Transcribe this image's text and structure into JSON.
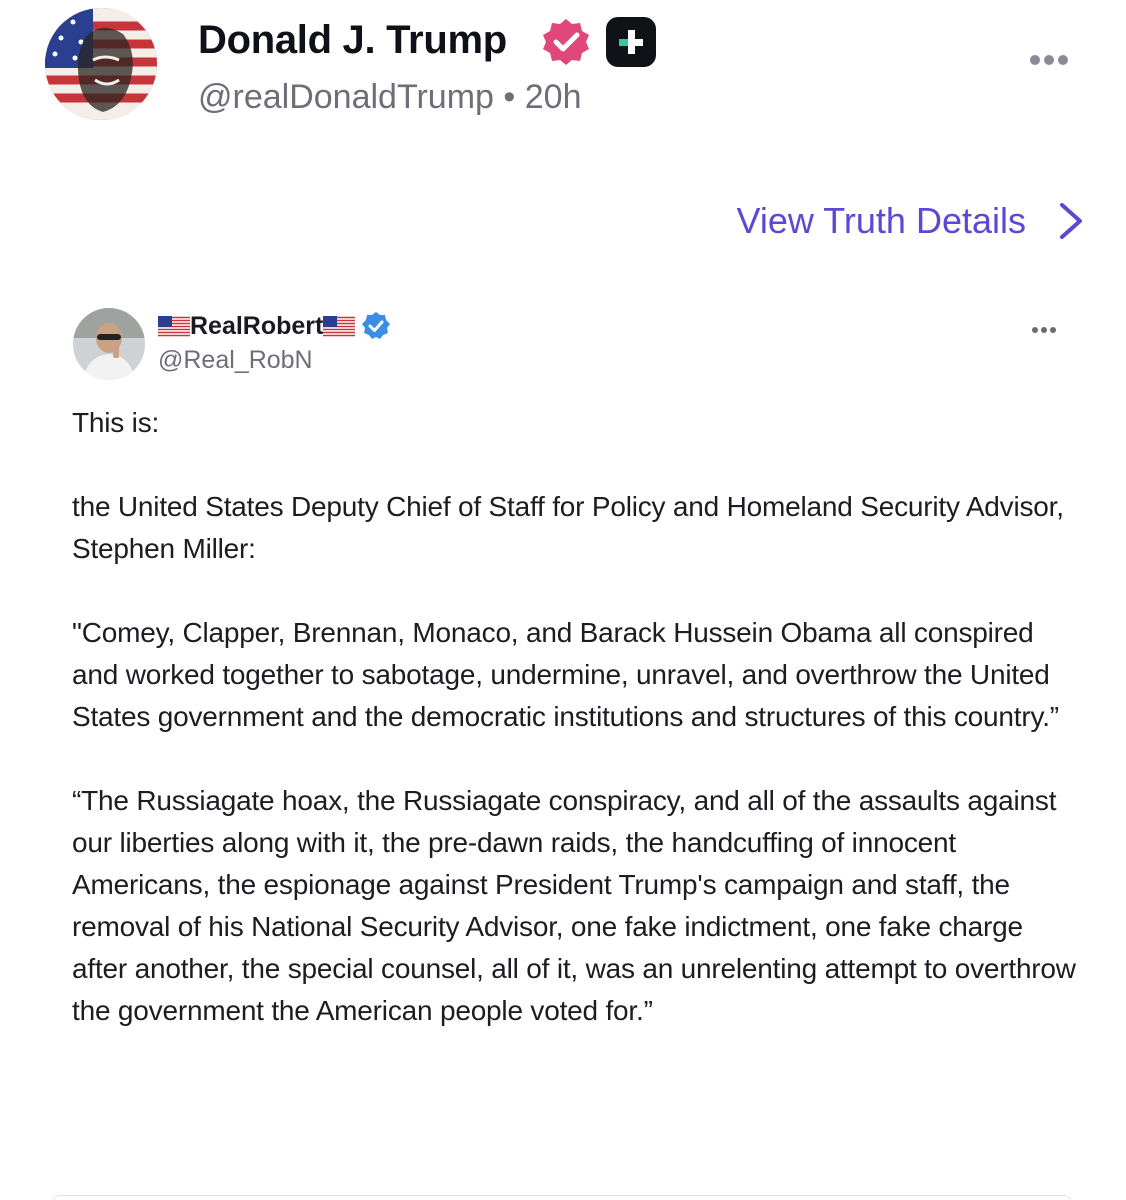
{
  "post": {
    "author_name": "Donald J. Trump",
    "handle": "@realDonaldTrump",
    "separator": "•",
    "time": "20h",
    "avatar_icon": "avatar-image",
    "verified_icon": "verified-badge-icon",
    "plus_icon": "plus-badge-icon",
    "more_icon": "more-options-icon"
  },
  "details_link": {
    "label": "View Truth Details",
    "icon": "chevron-right-icon"
  },
  "quoted": {
    "name": "RealRobert",
    "flag_icon": "us-flag-icon",
    "handle": "@Real_RobN",
    "verified_icon": "verified-check-icon",
    "paragraphs": [
      "This is:",
      "the United States Deputy Chief of Staff for Policy and Homeland Security Advisor, Stephen Miller:",
      "\"Comey, Clapper, Brennan, Monaco, and Barack Hussein Obama all conspired and worked together to sabotage, undermine, unravel, and overthrow the United States government and the democratic institutions and structures of this country.”",
      "“The Russiagate hoax, the Russiagate conspiracy, and all of the assaults against our liberties along with it, the pre-dawn raids, the handcuffing of innocent Americans, the espionage against President Trump's campaign and staff, the removal of his National Security Advisor, one fake indictment, one fake charge after another, the special counsel, all of it, was an unrelenting attempt to overthrow the government the American people voted for.”"
    ]
  },
  "colors": {
    "accent": "#5b48d6",
    "verified_pink": "#e0477a",
    "verified_blue": "#3b8ee8",
    "secondary_text": "#6e6e78"
  }
}
